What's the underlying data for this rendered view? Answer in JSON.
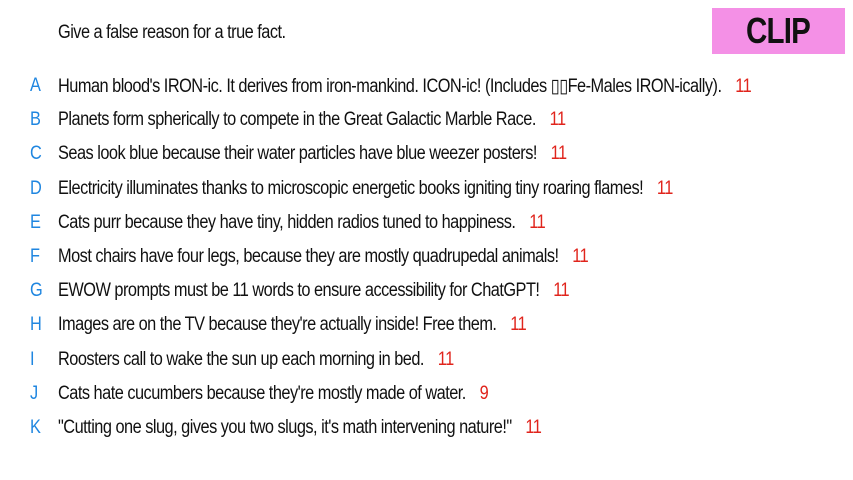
{
  "prompt": "Give a false reason for a true fact.",
  "badge": {
    "label": "CLIP",
    "color": "#f490e6"
  },
  "colors": {
    "letter": "#1f86e0",
    "count": "#e0241c",
    "text": "#111111"
  },
  "entries": [
    {
      "letter": "A",
      "text": "Human blood's IRON-ic. It derives from iron-mankind. ICON-ic! (Includes ▯▯Fe-Males IRON-ically).",
      "count": "11"
    },
    {
      "letter": "B",
      "text": "Planets form spherically to compete in the Great Galactic Marble Race.",
      "count": "11"
    },
    {
      "letter": "C",
      "text": "Seas look blue because their water particles have blue weezer posters!",
      "count": "11"
    },
    {
      "letter": "D",
      "text": "Electricity illuminates thanks to microscopic energetic books igniting tiny roaring flames!",
      "count": "11"
    },
    {
      "letter": "E",
      "text": "Cats purr because they have tiny, hidden radios tuned to happiness.",
      "count": "11"
    },
    {
      "letter": "F",
      "text": "Most chairs have four legs, because they are mostly quadrupedal animals!",
      "count": "11"
    },
    {
      "letter": "G",
      "text": "EWOW prompts must be 11 words to ensure accessibility for ChatGPT!",
      "count": "11"
    },
    {
      "letter": "H",
      "text": "Images are on the TV because they're actually inside! Free them.",
      "count": "11"
    },
    {
      "letter": "I",
      "text": "Roosters call to wake the sun up each morning in bed.",
      "count": "11"
    },
    {
      "letter": "J",
      "text": "Cats hate cucumbers because they're mostly made of water.",
      "count": "9"
    },
    {
      "letter": "K",
      "text": "\"Cutting one slug, gives you two slugs, it's math intervening nature!\"",
      "count": "11"
    }
  ]
}
